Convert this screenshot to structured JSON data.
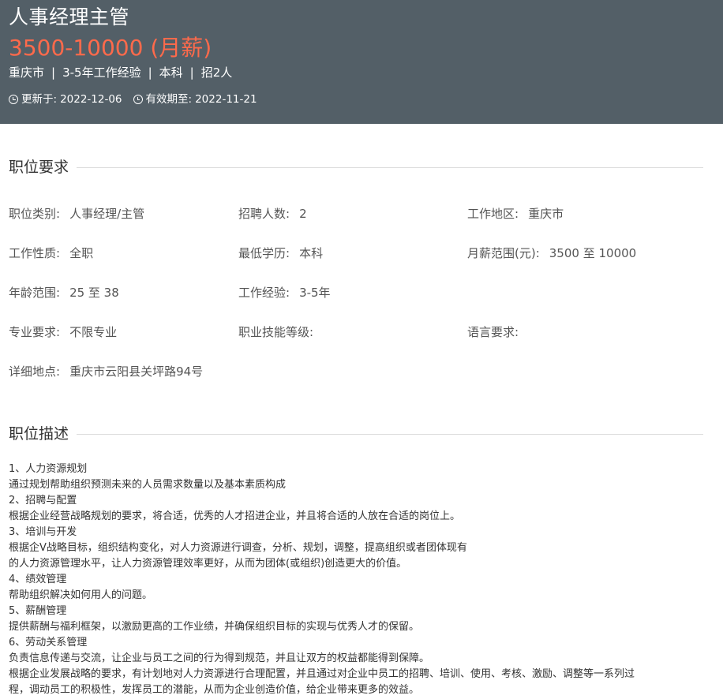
{
  "header": {
    "title": "人事经理主管",
    "salary": "3500-10000 (月薪)",
    "city": "重庆市",
    "experience": "3-5年工作经验",
    "education": "本科",
    "openings": "招2人",
    "separator": "|",
    "updated_label": "更新于:",
    "updated_value": "2022-12-06",
    "valid_label": "有效期至:",
    "valid_value": "2022-11-21"
  },
  "requirements": {
    "title": "职位要求",
    "fields": [
      {
        "label": "职位类别:",
        "value": "人事经理/主管"
      },
      {
        "label": "招聘人数:",
        "value": "2"
      },
      {
        "label": "工作地区:",
        "value": "重庆市"
      },
      {
        "label": "工作性质:",
        "value": "全职"
      },
      {
        "label": "最低学历:",
        "value": "本科"
      },
      {
        "label": "月薪范围(元):",
        "value": "3500 至 10000"
      },
      {
        "label": "年龄范围:",
        "value": "25 至 38"
      },
      {
        "label": "工作经验:",
        "value": "3-5年"
      },
      {
        "label": "",
        "value": ""
      },
      {
        "label": "专业要求:",
        "value": "不限专业"
      },
      {
        "label": "职业技能等级:",
        "value": ""
      },
      {
        "label": "语言要求:",
        "value": ""
      },
      {
        "label": "详细地点:",
        "value": "重庆市云阳县关坪路94号"
      }
    ]
  },
  "description": {
    "title": "职位描述",
    "lines": [
      "1、人力资源规划",
      "通过规划帮助组织预测未来的人员需求数量以及基本素质构成",
      "2、招聘与配置",
      "根据企业经营战略规划的要求，将合适，优秀的人才招进企业，并且将合适的人放在合适的岗位上。",
      "3、培训与开发",
      "根据企V战略目标，组织结构变化，对人力资源进行调查，分析、规划，调整，提高组织或者团体现有",
      "的人力资源管理水平，让人力资源管理效率更好，从而为团体(或组织)创造更大的价值。",
      "4、绩效管理",
      "帮助组织解决如何用人的问题。",
      "5、薪酬管理",
      "提供薪酬与福利框架，以激励更高的工作业绩，并确保组织目标的实现与优秀人才的保留。",
      "6、劳动关系管理",
      "负责信息传递与交流，让企业与员工之间的行为得到规范，并且让双方的权益都能得到保障。",
      "根据企业发展战略的要求，有计划地对人力资源进行合理配置，并且通过对企业中员工的招聘、培训、使用、考核、激励、调整等一系列过",
      "程，调动员工的积极性，发挥员工的潜能，从而为企业创造价值，给企业带来更多的效益。"
    ]
  }
}
